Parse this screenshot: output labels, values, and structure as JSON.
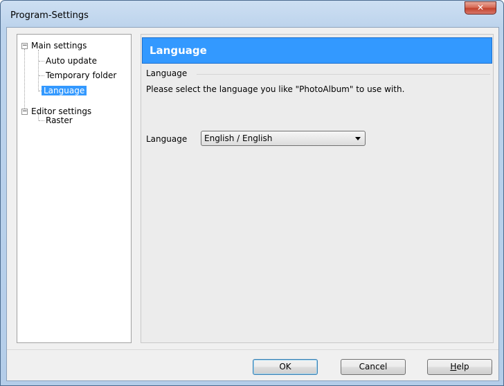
{
  "window": {
    "title": "Program-Settings",
    "close_symbol": "✕"
  },
  "tree": {
    "main_settings": "Main settings",
    "auto_update": "Auto update",
    "temporary_folder": "Temporary folder",
    "language": "Language",
    "editor_settings": "Editor settings",
    "raster": "Raster",
    "expander_symbol": "−"
  },
  "panel": {
    "header": "Language",
    "group_title": "Language",
    "description": "Please select the language you like \"PhotoAlbum\" to use with.",
    "language_label": "Language",
    "language_value": "English / English"
  },
  "buttons": {
    "ok": "OK",
    "cancel": "Cancel",
    "help_first": "H",
    "help_rest": "elp"
  },
  "colors": {
    "selection": "#3399ff",
    "close": "#c2402a"
  }
}
